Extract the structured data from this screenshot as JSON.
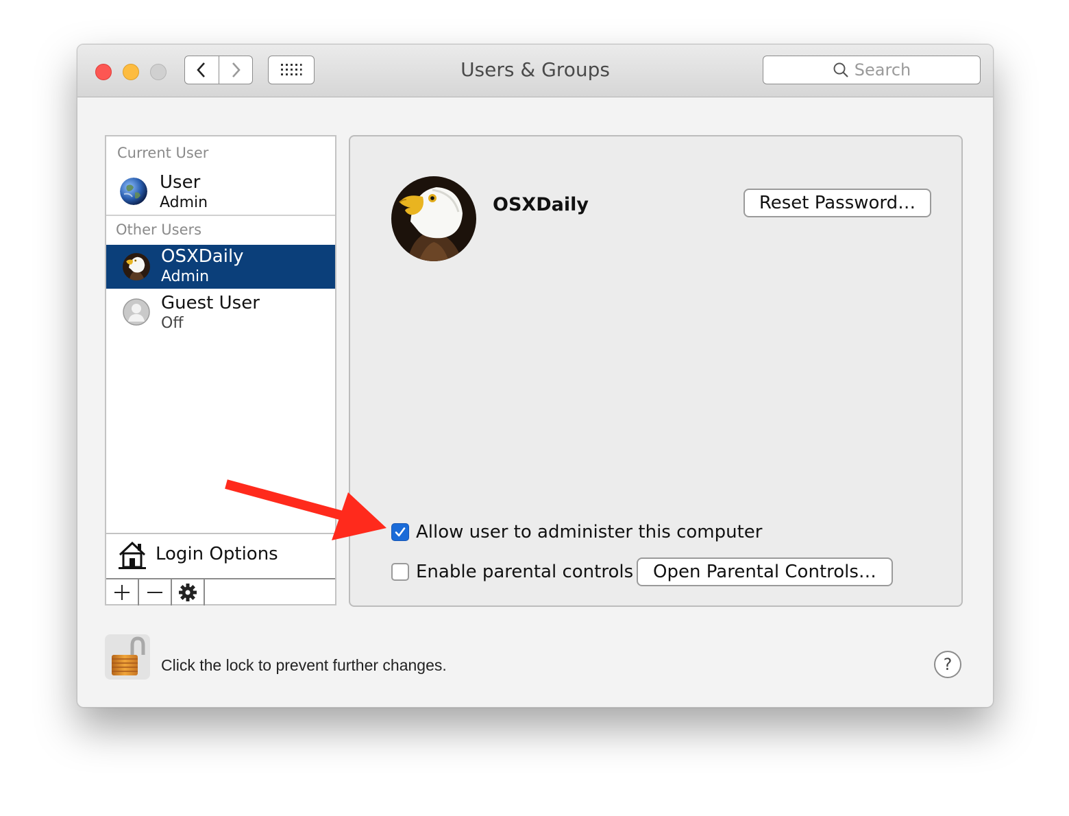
{
  "window": {
    "title": "Users & Groups",
    "search_placeholder": "Search"
  },
  "sidebar": {
    "current_user_header": "Current User",
    "current_user": {
      "name": "User",
      "role": "Admin"
    },
    "other_users_header": "Other Users",
    "other_users": [
      {
        "name": "OSXDaily",
        "role": "Admin",
        "selected": true
      },
      {
        "name": "Guest User",
        "role": "Off",
        "selected": false
      }
    ],
    "login_options_label": "Login Options",
    "toolbar_icons": [
      "plus-icon",
      "minus-icon",
      "gear-icon"
    ]
  },
  "panel": {
    "user_name": "OSXDaily",
    "reset_password_label": "Reset Password…",
    "allow_admin_label": "Allow user to administer this computer",
    "allow_admin_checked": true,
    "parental_label": "Enable parental controls",
    "parental_checked": false,
    "open_parental_label": "Open Parental Controls…"
  },
  "footer": {
    "lock_text": "Click the lock to prevent further changes.",
    "help_label": "?"
  },
  "colors": {
    "selection": "#0b3f7a",
    "checkbox_accent": "#1a6bd8",
    "annotation_arrow": "#ff2a1c"
  }
}
